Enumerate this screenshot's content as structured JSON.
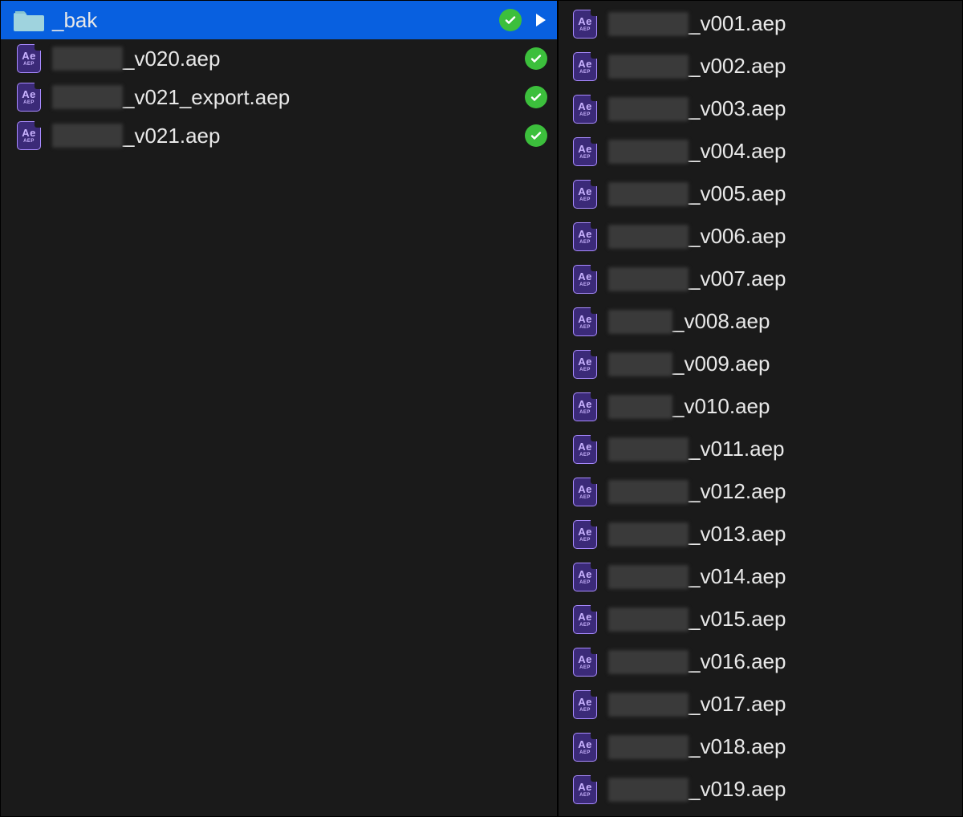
{
  "colors": {
    "selected_bg": "#0860e0",
    "check_green": "#3cbf3c",
    "aep_purple": "#3b2a78"
  },
  "left": {
    "items": [
      {
        "type": "folder",
        "name": "_bak",
        "check": true,
        "selected": true,
        "arrow": true
      },
      {
        "type": "aep",
        "blur_width": 88,
        "suffix": "_v020.aep",
        "check": true
      },
      {
        "type": "aep",
        "blur_width": 88,
        "suffix": "_v021_export.aep",
        "check": true
      },
      {
        "type": "aep",
        "blur_width": 88,
        "suffix": "_v021.aep",
        "check": true
      }
    ]
  },
  "right": {
    "items": [
      {
        "type": "aep",
        "blur_width": 100,
        "suffix": "_v001.aep"
      },
      {
        "type": "aep",
        "blur_width": 100,
        "suffix": "_v002.aep"
      },
      {
        "type": "aep",
        "blur_width": 100,
        "suffix": "_v003.aep"
      },
      {
        "type": "aep",
        "blur_width": 100,
        "suffix": "_v004.aep"
      },
      {
        "type": "aep",
        "blur_width": 100,
        "suffix": "_v005.aep"
      },
      {
        "type": "aep",
        "blur_width": 100,
        "suffix": "_v006.aep"
      },
      {
        "type": "aep",
        "blur_width": 100,
        "suffix": "_v007.aep"
      },
      {
        "type": "aep",
        "blur_width": 80,
        "suffix": "_v008.aep"
      },
      {
        "type": "aep",
        "blur_width": 80,
        "suffix": "_v009.aep"
      },
      {
        "type": "aep",
        "blur_width": 80,
        "suffix": "_v010.aep"
      },
      {
        "type": "aep",
        "blur_width": 100,
        "suffix": "_v011.aep"
      },
      {
        "type": "aep",
        "blur_width": 100,
        "suffix": "_v012.aep"
      },
      {
        "type": "aep",
        "blur_width": 100,
        "suffix": "_v013.aep"
      },
      {
        "type": "aep",
        "blur_width": 100,
        "suffix": "_v014.aep"
      },
      {
        "type": "aep",
        "blur_width": 100,
        "suffix": "_v015.aep"
      },
      {
        "type": "aep",
        "blur_width": 100,
        "suffix": "_v016.aep"
      },
      {
        "type": "aep",
        "blur_width": 100,
        "suffix": "_v017.aep"
      },
      {
        "type": "aep",
        "blur_width": 100,
        "suffix": "_v018.aep"
      },
      {
        "type": "aep",
        "blur_width": 100,
        "suffix": "_v019.aep"
      }
    ]
  },
  "icon_labels": {
    "aep_big": "Ae",
    "aep_small": "AEP"
  }
}
